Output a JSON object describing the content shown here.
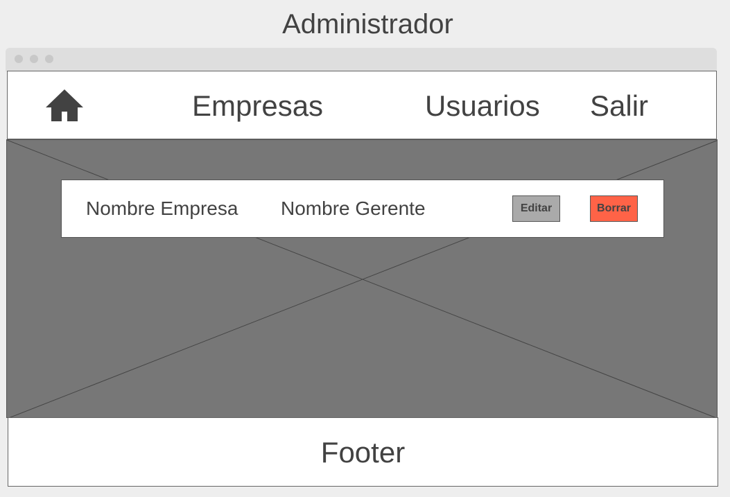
{
  "page": {
    "title": "Administrador"
  },
  "window": {
    "controls": [
      "dot",
      "dot",
      "dot"
    ]
  },
  "nav": {
    "home_icon": "home-icon",
    "links": [
      {
        "label": "Empresas"
      },
      {
        "label": "Usuarios"
      },
      {
        "label": "Salir"
      }
    ]
  },
  "hero": {
    "placeholder": "image-placeholder"
  },
  "row": {
    "company_name": "Nombre Empresa",
    "manager_name": "Nombre Gerente",
    "edit_label": "Editar",
    "delete_label": "Borrar"
  },
  "footer": {
    "label": "Footer"
  },
  "colors": {
    "background": "#eeeeee",
    "text": "#424242",
    "hero": "#777777",
    "edit_button": "#aaaaaa",
    "delete_button": "#ff6347"
  }
}
